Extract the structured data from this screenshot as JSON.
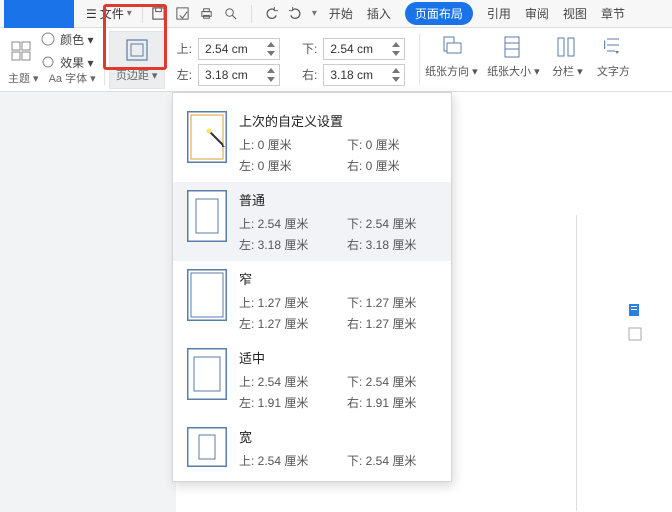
{
  "topbar": {
    "file_label": "文件"
  },
  "tabs": {
    "start": "开始",
    "insert": "插入",
    "layout": "页面布局",
    "reference": "引用",
    "review": "审阅",
    "view": "视图",
    "chapter": "章节"
  },
  "ribbon": {
    "theme_label": "主题 ▾",
    "font_label": "Aa 字体 ▾",
    "color_label": "颜色 ▾",
    "effect_label": "效果 ▾",
    "margins_label": "页边距 ▾",
    "dim_top_lbl": "上:",
    "dim_top_val": "2.54 cm",
    "dim_bottom_lbl": "下:",
    "dim_bottom_val": "2.54 cm",
    "dim_left_lbl": "左:",
    "dim_left_val": "3.18 cm",
    "dim_right_lbl": "右:",
    "dim_right_val": "3.18 cm",
    "orientation_label": "纸张方向 ▾",
    "size_label": "纸张大小 ▾",
    "columns_label": "分栏 ▾",
    "textdir_label": "文字方"
  },
  "dropdown": {
    "items": [
      {
        "title": "上次的自定义设置",
        "top": "上: 0 厘米",
        "bottom": "下: 0 厘米",
        "left": "左: 0 厘米",
        "right": "右: 0 厘米"
      },
      {
        "title": "普通",
        "top": "上: 2.54 厘米",
        "bottom": "下: 2.54 厘米",
        "left": "左: 3.18 厘米",
        "right": "右: 3.18 厘米"
      },
      {
        "title": "窄",
        "top": "上: 1.27 厘米",
        "bottom": "下: 1.27 厘米",
        "left": "左: 1.27 厘米",
        "right": "右: 1.27 厘米"
      },
      {
        "title": "适中",
        "top": "上: 2.54 厘米",
        "bottom": "下: 2.54 厘米",
        "left": "左: 1.91 厘米",
        "right": "右: 1.91 厘米"
      },
      {
        "title": "宽",
        "top": "上: 2.54 厘米",
        "bottom": "下: 2.54 厘米",
        "left": "",
        "right": ""
      }
    ]
  }
}
